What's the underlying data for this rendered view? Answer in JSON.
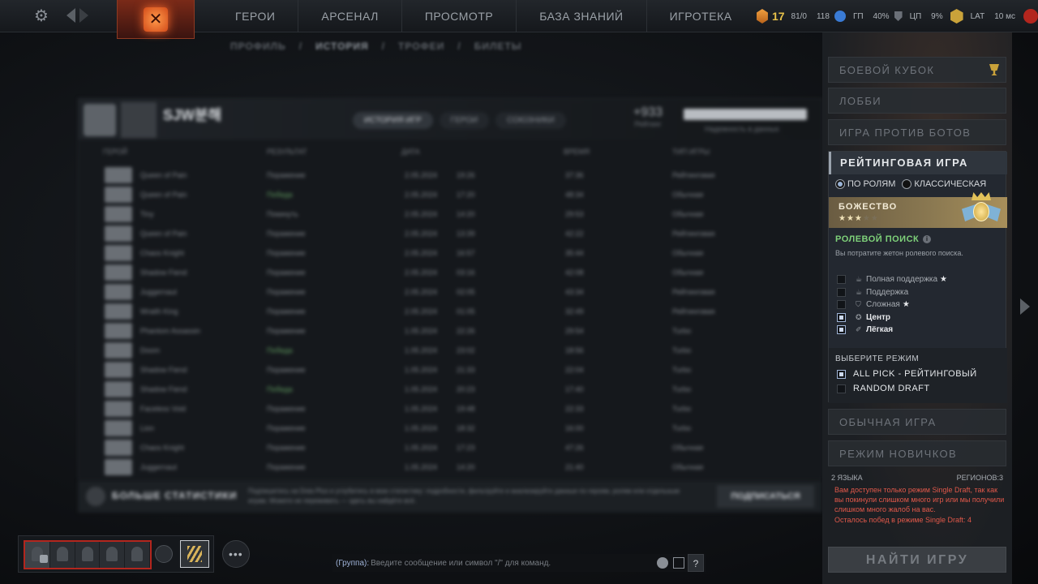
{
  "topbar": {
    "nav": [
      "ГЕРОИ",
      "АРСЕНАЛ",
      "ПРОСМОТР",
      "БАЗА ЗНАНИЙ",
      "ИГРОТЕКА"
    ],
    "level": "17",
    "stat1": "81/0",
    "stat2": "118",
    "cpu_label": "ГП",
    "cpu": "40%",
    "cpu2_label": "ЦП",
    "cpu2": "9%",
    "lat_label": "LAT",
    "lat": "10 мс"
  },
  "subnav": [
    "ПРОФИЛЬ",
    "ИСТОРИЯ",
    "ТРОФЕИ",
    "БИЛЕТЫ"
  ],
  "profile": {
    "name": "SJW분해",
    "tabs": [
      "ИСТОРИЯ ИГР",
      "ГЕРОИ",
      "СОЮЗНИКИ"
    ],
    "stat_value": "+933",
    "stat_label": "Рейтинг",
    "bar_label": "Надежность в данных",
    "columns": [
      "ГЕРОЙ",
      "РЕЗУЛЬТАТ",
      "ДАТА",
      "ВРЕМЯ",
      "ТИП ИГРЫ"
    ],
    "rows": [
      {
        "hero": "Queen of Pain",
        "result": "Поражение",
        "date": "2.05.2024",
        "time": "19:26",
        "dur": "37:36",
        "type": "Рейтинговая",
        "win": false
      },
      {
        "hero": "Queen of Pain",
        "result": "Победа",
        "date": "2.05.2024",
        "time": "17:20",
        "dur": "48:34",
        "type": "Обычная",
        "win": true
      },
      {
        "hero": "Tiny",
        "result": "Покинуть",
        "date": "2.05.2024",
        "time": "14:20",
        "dur": "29:53",
        "type": "Обычная",
        "win": false
      },
      {
        "hero": "Queen of Pain",
        "result": "Поражение",
        "date": "2.05.2024",
        "time": "13:39",
        "dur": "42:22",
        "type": "Рейтинговая",
        "win": false
      },
      {
        "hero": "Chaos Knight",
        "result": "Поражение",
        "date": "2.05.2024",
        "time": "16:57",
        "dur": "35:44",
        "type": "Обычная",
        "win": false
      },
      {
        "hero": "Shadow Fiend",
        "result": "Поражение",
        "date": "2.05.2024",
        "time": "03:16",
        "dur": "42:08",
        "type": "Обычная",
        "win": false
      },
      {
        "hero": "Juggernaut",
        "result": "Поражение",
        "date": "2.05.2024",
        "time": "02:05",
        "dur": "43:34",
        "type": "Рейтинговая",
        "win": false
      },
      {
        "hero": "Wraith King",
        "result": "Поражение",
        "date": "2.05.2024",
        "time": "01:05",
        "dur": "32:49",
        "type": "Рейтинговая",
        "win": false
      },
      {
        "hero": "Phantom Assassin",
        "result": "Поражение",
        "date": "1.05.2024",
        "time": "22:26",
        "dur": "29:54",
        "type": "Turbo",
        "win": false
      },
      {
        "hero": "Doom",
        "result": "Победа",
        "date": "1.05.2024",
        "time": "23:02",
        "dur": "18:56",
        "type": "Turbo",
        "win": true
      },
      {
        "hero": "Shadow Fiend",
        "result": "Поражение",
        "date": "1.05.2024",
        "time": "21:33",
        "dur": "22:04",
        "type": "Turbo",
        "win": false
      },
      {
        "hero": "Shadow Fiend",
        "result": "Победа",
        "date": "1.05.2024",
        "time": "20:23",
        "dur": "17:40",
        "type": "Turbo",
        "win": true
      },
      {
        "hero": "Faceless Void",
        "result": "Поражение",
        "date": "1.05.2024",
        "time": "19:48",
        "dur": "22:33",
        "type": "Turbo",
        "win": false
      },
      {
        "hero": "Lion",
        "result": "Поражение",
        "date": "1.05.2024",
        "time": "18:32",
        "dur": "16:00",
        "type": "Turbo",
        "win": false
      },
      {
        "hero": "Chaos Knight",
        "result": "Поражение",
        "date": "1.05.2024",
        "time": "17:23",
        "dur": "47:26",
        "type": "Обычная",
        "win": false
      },
      {
        "hero": "Juggernaut",
        "result": "Поражение",
        "date": "1.05.2024",
        "time": "14:20",
        "dur": "21:40",
        "type": "Обычная",
        "win": false
      }
    ]
  },
  "more_stats": {
    "title": "БОЛЬШЕ СТАТИСТИКИ",
    "text": "Подпишитесь на Dota Plus и углубитесь в мою статистику: подробности, фильтруйте и анализируйте данные по героям, ролям или отдельным играм. Можете не переживать — здесь вы найдёте всё.",
    "button": "ПОДПИСАТЬСЯ"
  },
  "right": {
    "modes_top": [
      "БОЕВОЙ КУБОК",
      "ЛОББИ",
      "ИГРА ПРОТИВ БОТОВ"
    ],
    "ranked_title": "РЕЙТИНГОВАЯ ИГРА",
    "radio": [
      "ПО РОЛЯМ",
      "КЛАССИЧЕСКАЯ"
    ],
    "rank_name": "БОЖЕСТВО",
    "rank_stars_on": "★★★",
    "rank_stars_off": "★★",
    "role_title": "РОЛЕВОЙ ПОИСК",
    "role_desc": "Вы потратите жетон ролевого поиска.",
    "roles": [
      {
        "label": "Полная поддержка",
        "star": true,
        "sel": false,
        "icon": "☕"
      },
      {
        "label": "Поддержка",
        "star": false,
        "sel": false,
        "icon": "☕"
      },
      {
        "label": "Сложная",
        "star": true,
        "sel": false,
        "icon": "⛉"
      },
      {
        "label": "Центр",
        "star": false,
        "sel": true,
        "icon": "✪"
      },
      {
        "label": "Лёгкая",
        "star": false,
        "sel": true,
        "icon": "✐"
      }
    ],
    "mode_sec_title": "ВЫБЕРИТЕ РЕЖИМ",
    "mode_opts": [
      "ALL PICK - РЕЙТИНГОВЫЙ",
      "RANDOM DRAFT"
    ],
    "modes_bottom": [
      "ОБЫЧНАЯ ИГРА",
      "РЕЖИМ НОВИЧКОВ"
    ],
    "languages": "2 ЯЗЫКА",
    "regions": "РЕГИОНОВ:3",
    "warning": "Вам доступен только режим Single Draft, так как вы покинули слишком много игр или мы получили слишком много жалоб на вас.",
    "warning2": "Осталось побед в режиме Single Draft: 4",
    "find_button": "НАЙТИ ИГРУ"
  },
  "chat": {
    "channel": "(Группа):",
    "placeholder": "Введите сообщение или символ \"/\" для команд.",
    "help": "?"
  }
}
